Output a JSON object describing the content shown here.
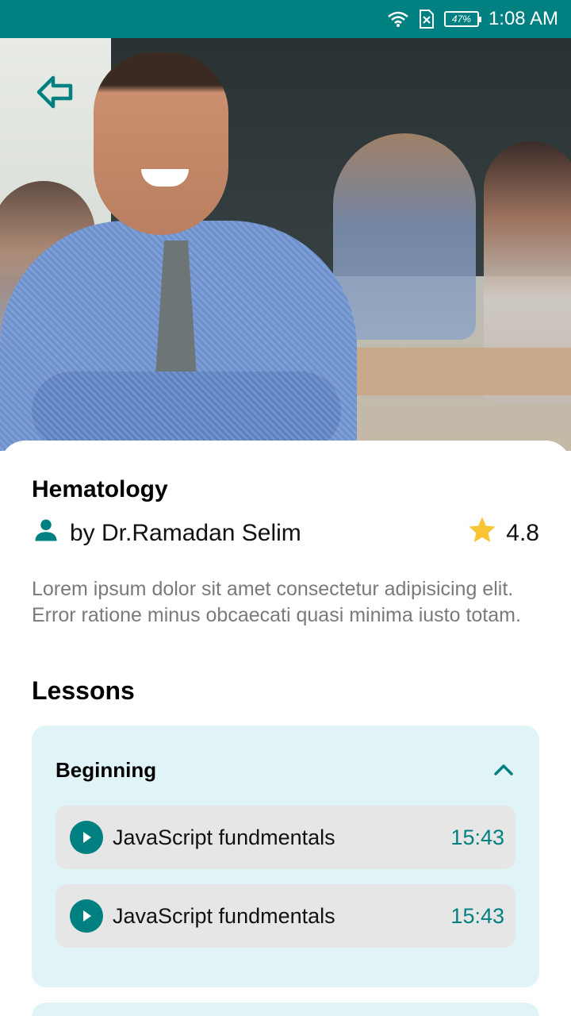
{
  "status_bar": {
    "time": "1:08 AM",
    "battery_percent": "47%",
    "icons": [
      "wifi-icon",
      "sim-error-icon",
      "battery-icon"
    ]
  },
  "header": {
    "back_icon": "back-arrow-icon",
    "hero_image": "teacher-classroom-photo"
  },
  "course": {
    "title": "Hematology",
    "author": "by Dr.Ramadan Selim",
    "rating": "4.8",
    "description": "Lorem ipsum dolor sit amet consectetur adipisicing elit. Error ratione minus obcaecati quasi minima iusto totam."
  },
  "lessons": {
    "heading": "Lessons",
    "sections": [
      {
        "title": "Beginning",
        "expanded": true,
        "items": [
          {
            "title": "JavaScript fundmentals",
            "duration": "15:43"
          },
          {
            "title": "JavaScript fundmentals",
            "duration": "15:43"
          }
        ]
      }
    ]
  },
  "colors": {
    "accent": "#008080",
    "section_bg": "#E0F3F6",
    "lesson_bg": "#E6E6E6",
    "star": "#F7C531",
    "description_text": "#7A7A7A"
  }
}
